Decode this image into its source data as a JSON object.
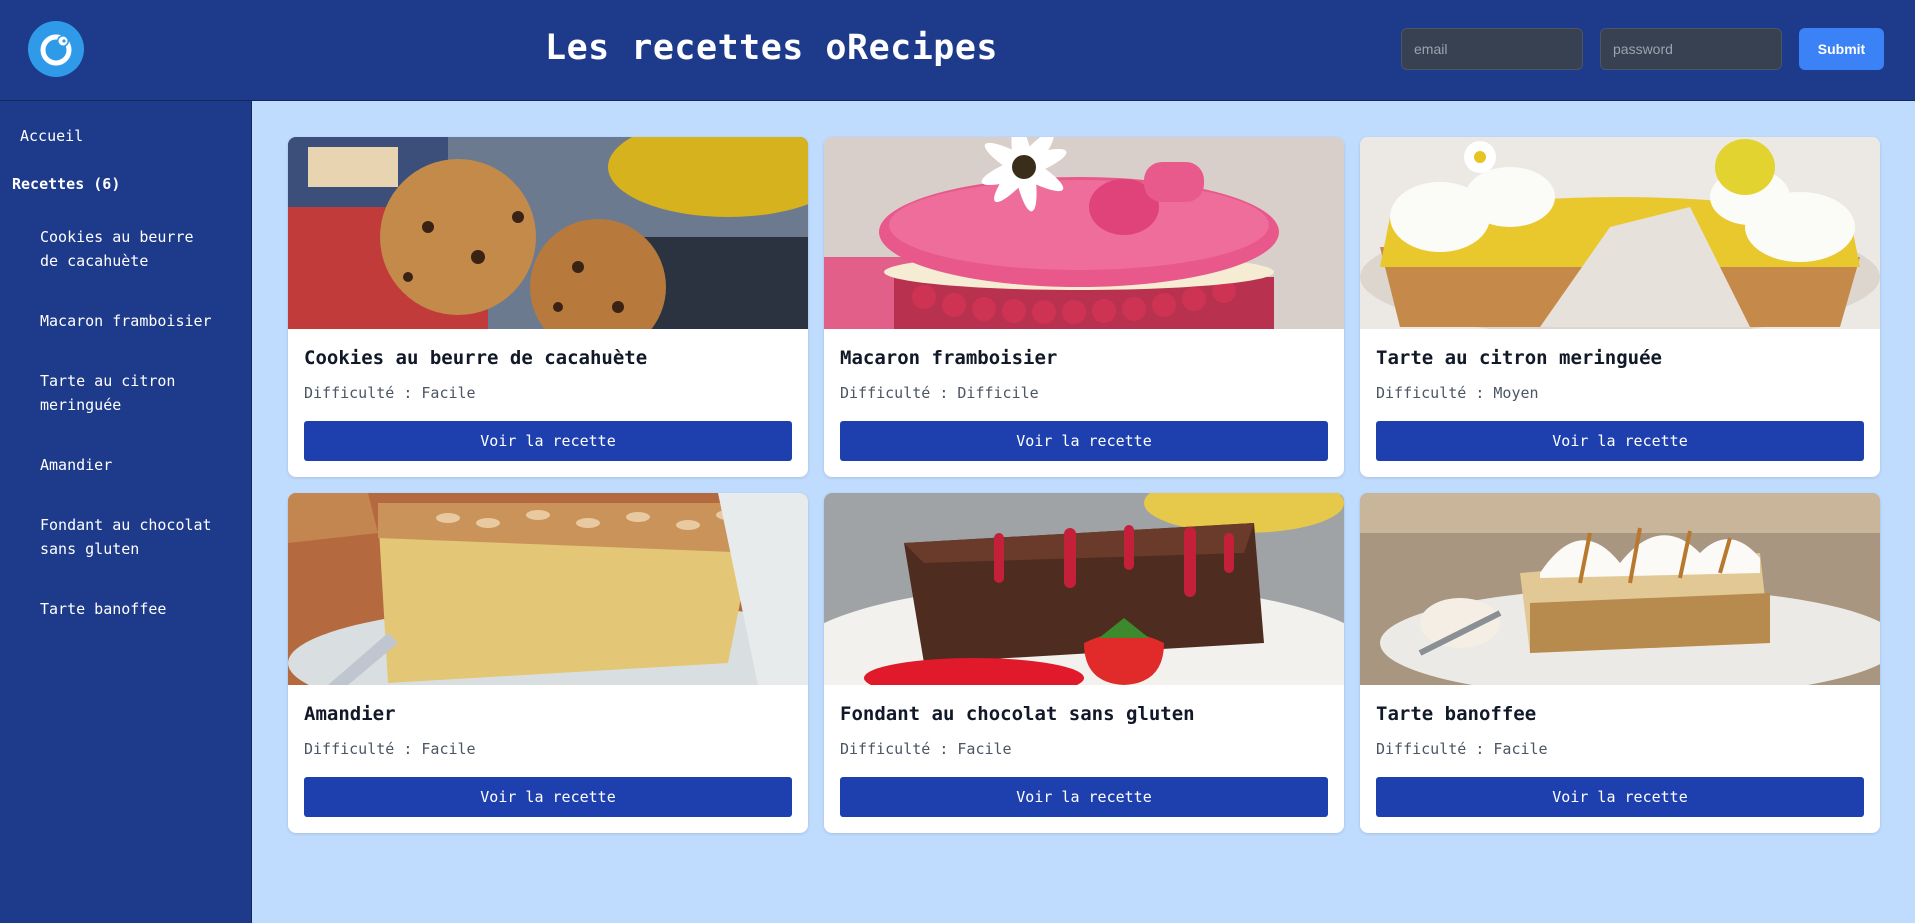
{
  "header": {
    "title": "Les recettes oRecipes",
    "email_placeholder": "email",
    "password_placeholder": "password",
    "submit_label": "Submit",
    "logo_icon": "orecipes-logo-icon"
  },
  "sidebar": {
    "home_label": "Accueil",
    "recipes_title": "Recettes (6)",
    "items": [
      {
        "label": "Cookies au beurre de cacahuète"
      },
      {
        "label": "Macaron framboisier"
      },
      {
        "label": "Tarte au citron meringuée"
      },
      {
        "label": "Amandier"
      },
      {
        "label": "Fondant au chocolat sans gluten"
      },
      {
        "label": "Tarte banoffee"
      }
    ]
  },
  "recipes": [
    {
      "title": "Cookies au beurre de cacahuète",
      "difficulty": "Difficulté : Facile",
      "button": "Voir la recette",
      "image": "cookies-photo"
    },
    {
      "title": "Macaron framboisier",
      "difficulty": "Difficulté : Difficile",
      "button": "Voir la recette",
      "image": "macaron-photo"
    },
    {
      "title": "Tarte au citron meringuée",
      "difficulty": "Difficulté : Moyen",
      "button": "Voir la recette",
      "image": "lemon-tart-photo"
    },
    {
      "title": "Amandier",
      "difficulty": "Difficulté : Facile",
      "button": "Voir la recette",
      "image": "almond-cake-photo"
    },
    {
      "title": "Fondant au chocolat sans gluten",
      "difficulty": "Difficulté : Facile",
      "button": "Voir la recette",
      "image": "chocolate-fondant-photo"
    },
    {
      "title": "Tarte banoffee",
      "difficulty": "Difficulté : Facile",
      "button": "Voir la recette",
      "image": "banoffee-photo"
    }
  ],
  "colors": {
    "header_bg": "#1e3a8a",
    "page_bg": "#bfdbfe",
    "button_bg": "#1e40af",
    "submit_bg": "#3b82f6"
  }
}
